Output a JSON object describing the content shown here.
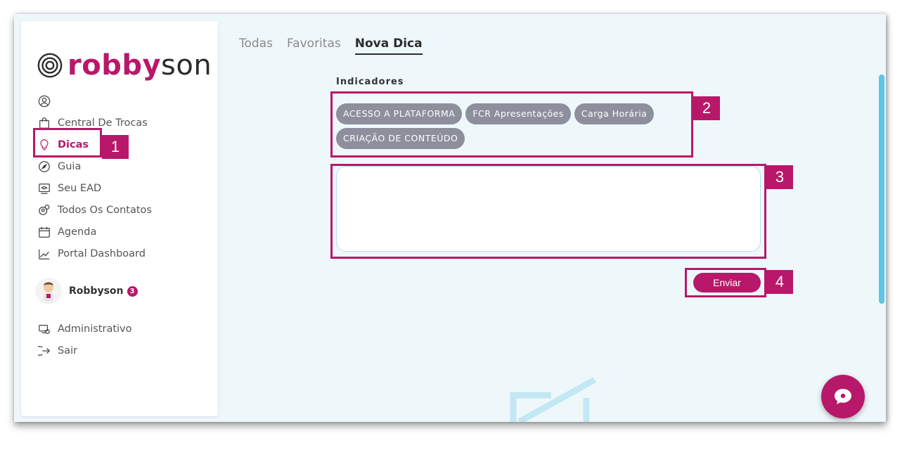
{
  "brand": {
    "logo_pink": "robby",
    "logo_dark": "son",
    "accent": "#b8186a"
  },
  "sidebar": {
    "items": [
      {
        "label": "",
        "icon": "user-circle-icon"
      },
      {
        "label": "Central De Trocas",
        "icon": "shopping-bag-icon"
      },
      {
        "label": "Dicas",
        "icon": "lightbulb-icon",
        "active": true
      },
      {
        "label": "Guia",
        "icon": "compass-icon"
      },
      {
        "label": "Seu EAD",
        "icon": "monitor-graduation-icon"
      },
      {
        "label": "Todos Os Contatos",
        "icon": "contacts-icon"
      },
      {
        "label": "Agenda",
        "icon": "calendar-icon"
      },
      {
        "label": "Portal Dashboard",
        "icon": "chart-line-icon"
      }
    ],
    "profile": {
      "name": "Robbyson",
      "badge": "3"
    },
    "bottom_items": [
      {
        "label": "Administrativo",
        "icon": "admin-icon"
      },
      {
        "label": "Sair",
        "icon": "logout-icon"
      }
    ]
  },
  "tabs": [
    {
      "label": "Todas"
    },
    {
      "label": "Favoritas"
    },
    {
      "label": "Nova Dica",
      "active": true
    }
  ],
  "form": {
    "section_title": "Indicadores",
    "chips": [
      "ACESSO A PLATAFORMA",
      "FCR Apresentações",
      "Carga Horária",
      "CRIAÇÃO DE CONTEÚDO"
    ],
    "textarea_value": "",
    "send_label": "Enviar"
  },
  "annotations": [
    "1",
    "2",
    "3",
    "4"
  ]
}
